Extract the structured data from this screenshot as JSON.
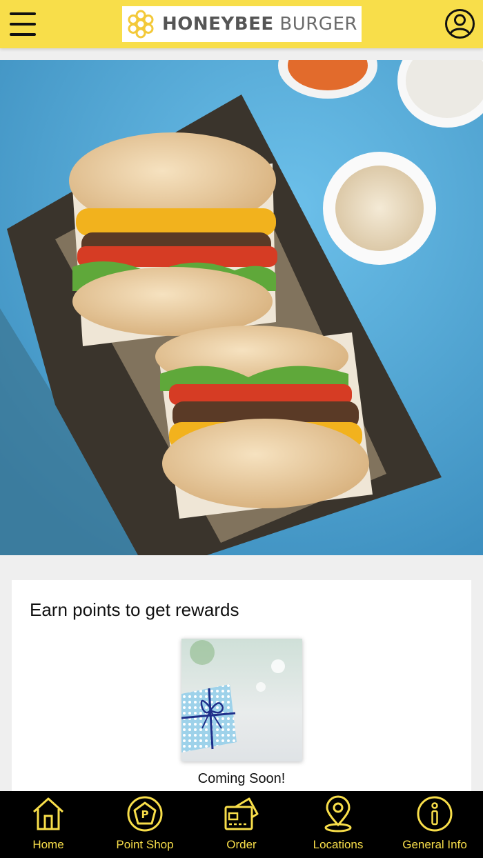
{
  "header": {
    "logo_bold": "HONEYBEE",
    "logo_light": "BURGER",
    "brand_color": "#f8de4a"
  },
  "carousel": {
    "slide_count": 4,
    "active_index": 0
  },
  "rewards": {
    "title": "Earn points to get rewards",
    "item_label": "Coming Soon!"
  },
  "tabbar": {
    "items": [
      {
        "label": "Home",
        "icon": "home-icon"
      },
      {
        "label": "Point Shop",
        "icon": "point-shop-icon"
      },
      {
        "label": "Order",
        "icon": "order-card-icon"
      },
      {
        "label": "Locations",
        "icon": "location-pin-icon"
      },
      {
        "label": "General Info",
        "icon": "info-icon"
      }
    ]
  }
}
